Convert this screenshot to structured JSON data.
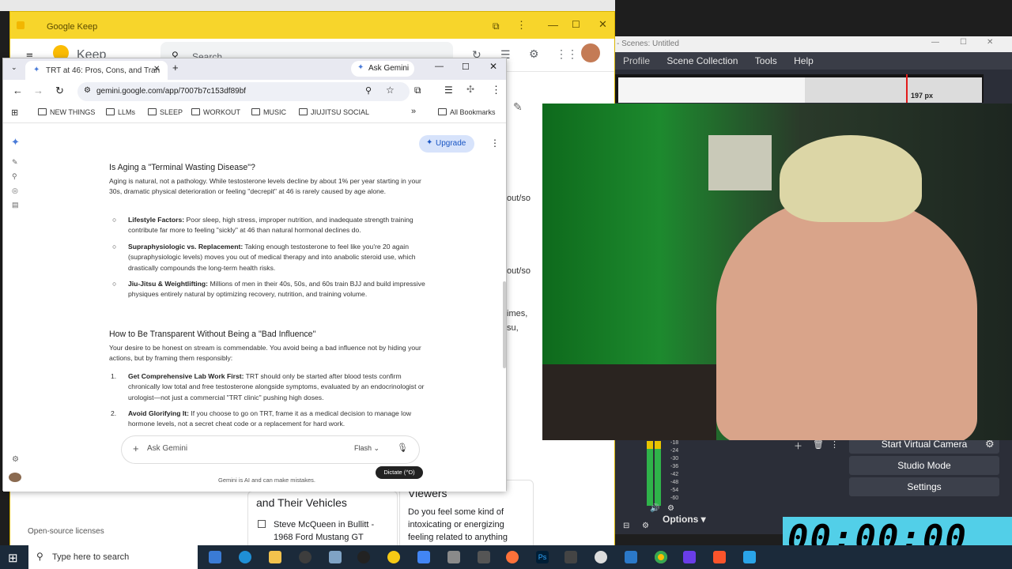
{
  "keep": {
    "window_title": "Google Keep",
    "app_name": "Keep",
    "search_placeholder": "Search",
    "bottom_link": "Open-source licenses",
    "list_heading": "and Their Vehicles",
    "list_item": "Steve McQueen in Bullitt - 1968 Ford Mustang GT",
    "note_heading": "Viewers",
    "note_text": "Do you feel some kind of intoxicating or energizing feeling related to anything",
    "side_fragments": [
      "out/so",
      "out/so",
      "imes,",
      "su,"
    ]
  },
  "obs": {
    "title": "- Scenes: Untitled",
    "menu": [
      "Profile",
      "Scene Collection",
      "Tools",
      "Help"
    ],
    "buttons": [
      "Start Virtual Camera",
      "Studio Mode",
      "Settings"
    ],
    "options_label": "Options",
    "meter_ticks": [
      "-18",
      "-24",
      "-30",
      "-36",
      "-42",
      "-48",
      "-54",
      "-60"
    ],
    "px_label": "197 px",
    "timer": "00:00:00"
  },
  "browser": {
    "tab_title": "TRT at 46: Pros, Cons, and Tran",
    "ask_gemini": "Ask Gemini",
    "url": "gemini.google.com/app/7007b7c153df89bf",
    "bookmarks": [
      "NEW THINGS",
      "LLMs",
      "SLEEP",
      "WORKOUT",
      "MUSIC",
      "JIUJITSU SOCIAL"
    ],
    "all_bookmarks": "All Bookmarks"
  },
  "gemini": {
    "upgrade": "Upgrade",
    "h1": "Is Aging a \"Terminal Wasting Disease\"?",
    "p1": "Aging is natural, not a pathology. While testosterone levels decline by about 1% per year starting in your 30s, dramatic physical deterioration or feeling \"decrepit\" at 46 is rarely caused by age alone.",
    "bullets": [
      {
        "bold": "Lifestyle Factors:",
        "text": " Poor sleep, high stress, improper nutrition, and inadequate strength training contribute far more to feeling \"sickly\" at 46 than natural hormonal declines do."
      },
      {
        "bold": "Supraphysiologic vs. Replacement:",
        "text": " Taking enough testosterone to feel like you're 20 again (supraphysiologic levels) moves you out of medical therapy and into anabolic steroid use, which drastically compounds the long-term health risks."
      },
      {
        "bold": "Jiu-Jitsu & Weightlifting:",
        "text": " Millions of men in their 40s, 50s, and 60s train BJJ and build impressive physiques entirely natural by optimizing recovery, nutrition, and training volume."
      }
    ],
    "h2": "How to Be Transparent Without Being a \"Bad Influence\"",
    "p2": "Your desire to be honest on stream is commendable. You avoid being a bad influence not by hiding your actions, but by framing them responsibly:",
    "numbered": [
      {
        "num": "1.",
        "bold": "Get Comprehensive Lab Work First:",
        "text": " TRT should only be started after blood tests confirm chronically low total and free testosterone alongside symptoms, evaluated by an endocrinologist or urologist—not just a commercial \"TRT clinic\" pushing high doses."
      },
      {
        "num": "2.",
        "bold": "Avoid Glorifying It:",
        "text": " If you choose to go on TRT, frame it as a medical decision to manage low hormone levels, not a secret cheat code or a replacement for hard work."
      }
    ],
    "input_placeholder": "Ask Gemini",
    "model": "Flash",
    "tooltip": "Dictate (^D)",
    "disclaimer": "Gemini is AI and can make mistakes."
  },
  "taskbar": {
    "search_placeholder": "Type here to search"
  }
}
